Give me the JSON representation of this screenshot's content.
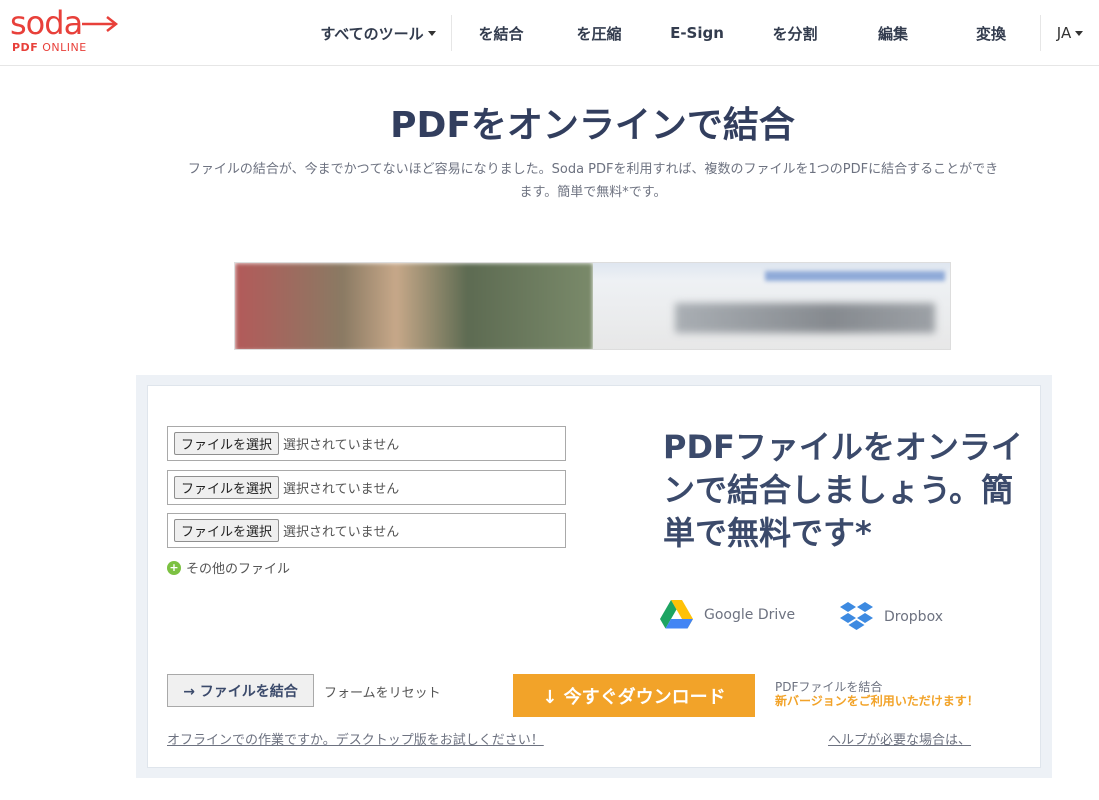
{
  "brand": {
    "logo_text": "soda",
    "logo_sub_bold": "PDF",
    "logo_sub": "ONLINE",
    "accent_color": "#e8403a"
  },
  "nav": {
    "items": [
      {
        "label": "すべてのツール"
      },
      {
        "label": "を結合"
      },
      {
        "label": "を圧縮"
      },
      {
        "label": "E-Sign"
      },
      {
        "label": "を分割"
      },
      {
        "label": "編集"
      },
      {
        "label": "変換"
      }
    ],
    "language": "JA"
  },
  "page": {
    "title": "PDFをオンラインで結合",
    "intro_line1": "ファイルの結合が、今までかつてないほど容易になりました。Soda PDFを利用すれば、複数のファイルを1つのPDFに結合することができ",
    "intro_line2": "ます。簡単で無料*です。"
  },
  "tool": {
    "file_inputs": [
      {
        "button_label": "ファイルを選択",
        "status": "選択されていません"
      },
      {
        "button_label": "ファイルを選択",
        "status": "選択されていません"
      },
      {
        "button_label": "ファイルを選択",
        "status": "選択されていません"
      }
    ],
    "more_files_label": "その他のファイル",
    "promo_heading": "PDFファイルをオンラインで結合しましょう。簡単で無料です*",
    "cloud": {
      "google_drive": "Google Drive",
      "dropbox": "Dropbox"
    },
    "merge_button": "→ ファイルを結合",
    "reset_link": "フォームをリセット",
    "download_button": "↓ 今すぐダウンロード",
    "version_note_line1": "PDFファイルを結合",
    "version_note_line2": "新バージョンをご利用いただけます！",
    "offline_link": "オフラインでの作業ですか。デスクトップ版をお試しください！",
    "help_link": "ヘルプが必要な場合は、",
    "download_color": "#f2a329"
  }
}
